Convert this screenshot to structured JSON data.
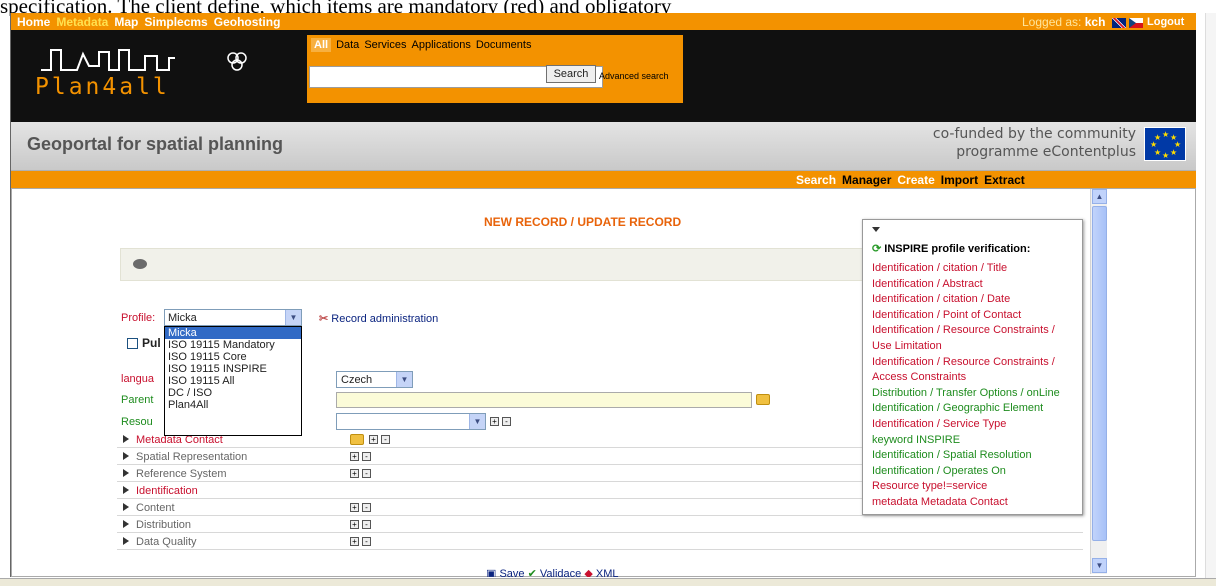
{
  "caption": "specification. The client define, which items are mandatory (red) and obligatory",
  "topnav": {
    "items": [
      "Home",
      "Metadata",
      "Map",
      "Simplecms",
      "Geohosting"
    ],
    "login_label": "Logged as:",
    "user": "kch",
    "logout": "Logout"
  },
  "logo": {
    "text": "Plan4all"
  },
  "search": {
    "tabs": [
      "All",
      "Data",
      "Services",
      "Applications",
      "Documents"
    ],
    "button": "Search",
    "advanced": "Advanced search"
  },
  "header": {
    "title": "Geoportal for spatial planning",
    "cofund_line1": "co-funded by the community",
    "cofund_line2": "programme eContentplus"
  },
  "menubar": {
    "items": [
      "Search",
      "Manager",
      "Create",
      "Import",
      "Extract"
    ]
  },
  "form": {
    "title": "NEW RECORD / UPDATE RECORD",
    "profile_label": "Profile:",
    "profile_value": "Micka",
    "record_admin": "Record administration",
    "profile_options": [
      "Micka",
      "ISO 19115 Mandatory",
      "ISO 19115 Core",
      "ISO 19115 INSPIRE",
      "ISO 19115 All",
      "DC / ISO",
      "Plan4All"
    ],
    "public_label": "Pul",
    "language_label": "langua",
    "language_value": "Czech",
    "parent_label": "Parent",
    "resource_label": "Resou",
    "sections": [
      {
        "label": "Metadata Contact",
        "required": true
      },
      {
        "label": "Spatial Representation",
        "required": false
      },
      {
        "label": "Reference System",
        "required": false
      },
      {
        "label": "Identification",
        "required": true
      },
      {
        "label": "Content",
        "required": false
      },
      {
        "label": "Distribution",
        "required": false
      },
      {
        "label": "Data Quality",
        "required": false
      }
    ],
    "actions": [
      "Save",
      "Validace",
      "XML"
    ]
  },
  "inspire": {
    "title": "INSPIRE profile verification:",
    "items": [
      {
        "text": "Identification / citation / Title",
        "status": "red"
      },
      {
        "text": "Identification / Abstract",
        "status": "red"
      },
      {
        "text": "Identification / citation / Date",
        "status": "red"
      },
      {
        "text": "Identification / Point of Contact",
        "status": "red"
      },
      {
        "text": "Identification / Resource Constraints / Use Limitation",
        "status": "red"
      },
      {
        "text": "Identification / Resource Constraints / Access Constraints",
        "status": "red"
      },
      {
        "text": "Distribution / Transfer Options / onLine",
        "status": "green"
      },
      {
        "text": "Identification / Geographic Element",
        "status": "green"
      },
      {
        "text": "Identification / Service Type",
        "status": "red"
      },
      {
        "text": "keyword INSPIRE",
        "status": "green"
      },
      {
        "text": "Identification / Spatial Resolution",
        "status": "green"
      },
      {
        "text": "Identification / Operates On",
        "status": "green"
      },
      {
        "text": "Resource type!=service",
        "status": "red"
      },
      {
        "text": "metadata Metadata Contact",
        "status": "red"
      }
    ]
  },
  "colors": {
    "orange": "#f39200",
    "required": "#c8102e",
    "ok": "#1e8c1e"
  }
}
